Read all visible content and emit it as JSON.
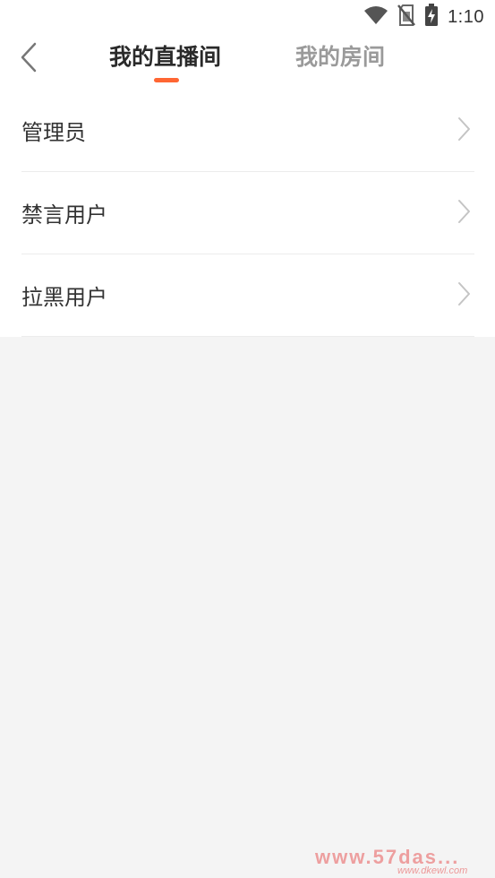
{
  "status_bar": {
    "time": "1:10",
    "icons": [
      "wifi-icon",
      "no-sim-icon",
      "battery-charging-icon"
    ]
  },
  "header": {
    "back_icon": "chevron-left-icon",
    "tabs": [
      {
        "label": "我的直播间",
        "active": true
      },
      {
        "label": "我的房间",
        "active": false
      }
    ],
    "accent_color": "#ff6633"
  },
  "menu": {
    "items": [
      {
        "label": "管理员",
        "icon": "chevron-right-icon"
      },
      {
        "label": "禁言用户",
        "icon": "chevron-right-icon"
      },
      {
        "label": "拉黑用户",
        "icon": "chevron-right-icon"
      }
    ]
  },
  "watermark": {
    "text": "www.57das...",
    "sub": "www.dkewl.com"
  }
}
